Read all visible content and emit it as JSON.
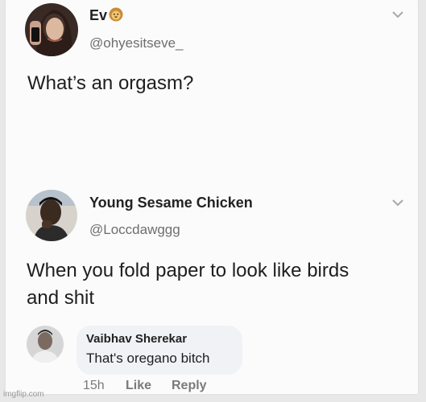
{
  "tweet1": {
    "author_name": "Ev",
    "author_emoji": "lion-face-icon",
    "handle": "@ohyesitseve_",
    "text": "What’s an orgasm?"
  },
  "tweet2": {
    "author_name": "Young Sesame Chicken",
    "handle": "@Loccdawggg",
    "text_line1": "When you fold paper to look like birds",
    "text_line2": "and shit"
  },
  "comment": {
    "author_name": "Vaibhav Sherekar",
    "text": "That's oregano bitch",
    "time": "15h",
    "like_label": "Like",
    "reply_label": "Reply"
  },
  "watermark": "imgflip.com",
  "colors": {
    "card_background": "#fbfbfb",
    "handle_gray": "#6e6e6e",
    "comment_bubble": "#f0f2f5",
    "action_gray": "#7a7a7a"
  }
}
